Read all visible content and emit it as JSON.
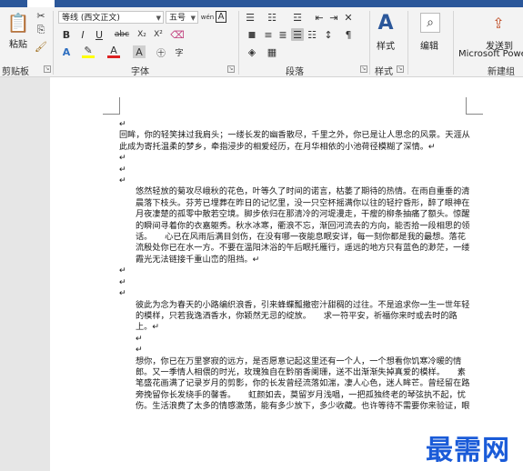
{
  "ribbon": {
    "clipboard": {
      "paste_label": "粘贴",
      "group_label": "剪贴板"
    },
    "font": {
      "font_name": "等线 (西文正文)",
      "font_size": "五号",
      "bold": "B",
      "italic": "I",
      "underline": "U",
      "strikethrough": "abc",
      "subscript": "X₂",
      "superscript": "X²",
      "text_effects": "A",
      "font_color": "A",
      "char_shading": "A",
      "char_border": "A",
      "group_label": "字体"
    },
    "paragraph": {
      "group_label": "段落"
    },
    "styles": {
      "styles_label": "样式",
      "group_label": "样式"
    },
    "editing": {
      "editing_label": "编辑"
    },
    "new_group": {
      "send_label": "发送到",
      "send_target": "Microsoft Powe",
      "group_label": "新建组"
    }
  },
  "document": {
    "paragraphs": [
      {
        "text": "↵",
        "indent": false
      },
      {
        "text": "回眸，你的轻笑抹过我肩头；一缕长发的幽香散尽，千里之外，你已是让人思念的风景。天涯从此成为寄托温柔的梦乡，牵指浸步的相爱经历，在月华相依的小池荷径模糊了深情。↵",
        "indent": false
      },
      {
        "text": "↵",
        "indent": false
      },
      {
        "text": "↵",
        "indent": false
      },
      {
        "text": "↵",
        "indent": false
      },
      {
        "text": "悠然轻放的菊攻尽峨秋的花色，叶等久了时间的诺言，枯萎了期待的热情。在雨自重垂的清晨落下枝头。芬芳已埋葬在昨日的记忆里，没一只空杯摇满你以往的轻拧昏形，醉了眼神在月夜凄楚的孤零中散若空境。脚步依归在那清冷的河堤漫走，干瘦的柳条抽痛了额头。惊醒的瞬间寻着你的衣嘉躯秀。秋水冰寒，衢浪不忘，渐回河流去的方向，能否拾一段相思的领话。　　心已在风雨后满目剑伤，在没有哪一夜能息眠安详，每一刻你都是我的最想。落花流殷处你已在水一方。不要在温阳沐浴的午后眠托雁行，遥远的地方只有蓝色的渺茫，一缕霞光无法链接千重山峦的阻挡。↵",
        "indent": true
      },
      {
        "text": "↵",
        "indent": false
      },
      {
        "text": "↵",
        "indent": false
      },
      {
        "text": "↵",
        "indent": false
      },
      {
        "text": "彼此为念为春天的小路编织浪香，引来蜂蝶瓢撒密汁甜稠的过往。不是追求你一生一世年轻的模样，只若我逸洒香水，你颖然无忌的绽放。　　求一符平安，祈福你来时或去时的路上。↵",
        "indent": true
      },
      {
        "text": "↵",
        "indent": true
      },
      {
        "text": "↵",
        "indent": true
      },
      {
        "text": "想你，你已在万里寥寂的远方，是否愿意记起这里还有一个人，一个想看你饥寒冷暖的情郎。又一季情人相偎的时光，玫瑰独自在黔丽香阑珊，送不出渐渐失掉真爱的模样。　　素笔盛花画满了记录岁月的剪影，你的长发曾经流落如湍，凄人心色，迷人眸芒。曾经留在路旁挽留你长发绕手的馨香。　　虹颜如去，莫留岁月浅唱，一把孤独终老的琴弦执不起，忧伤。生活浪费了太多的情感激荡，能有多少放下，多少收藏。也许等待不需要你来验证，眼",
        "indent": true
      }
    ]
  },
  "watermark": "最需网",
  "colors": {
    "title_bar": "#2b579a",
    "ribbon_bg": "#f3f3f3",
    "page_bg": "#ffffff",
    "canvas_bg": "#e6e6e6",
    "watermark": "#1a5bd8"
  }
}
